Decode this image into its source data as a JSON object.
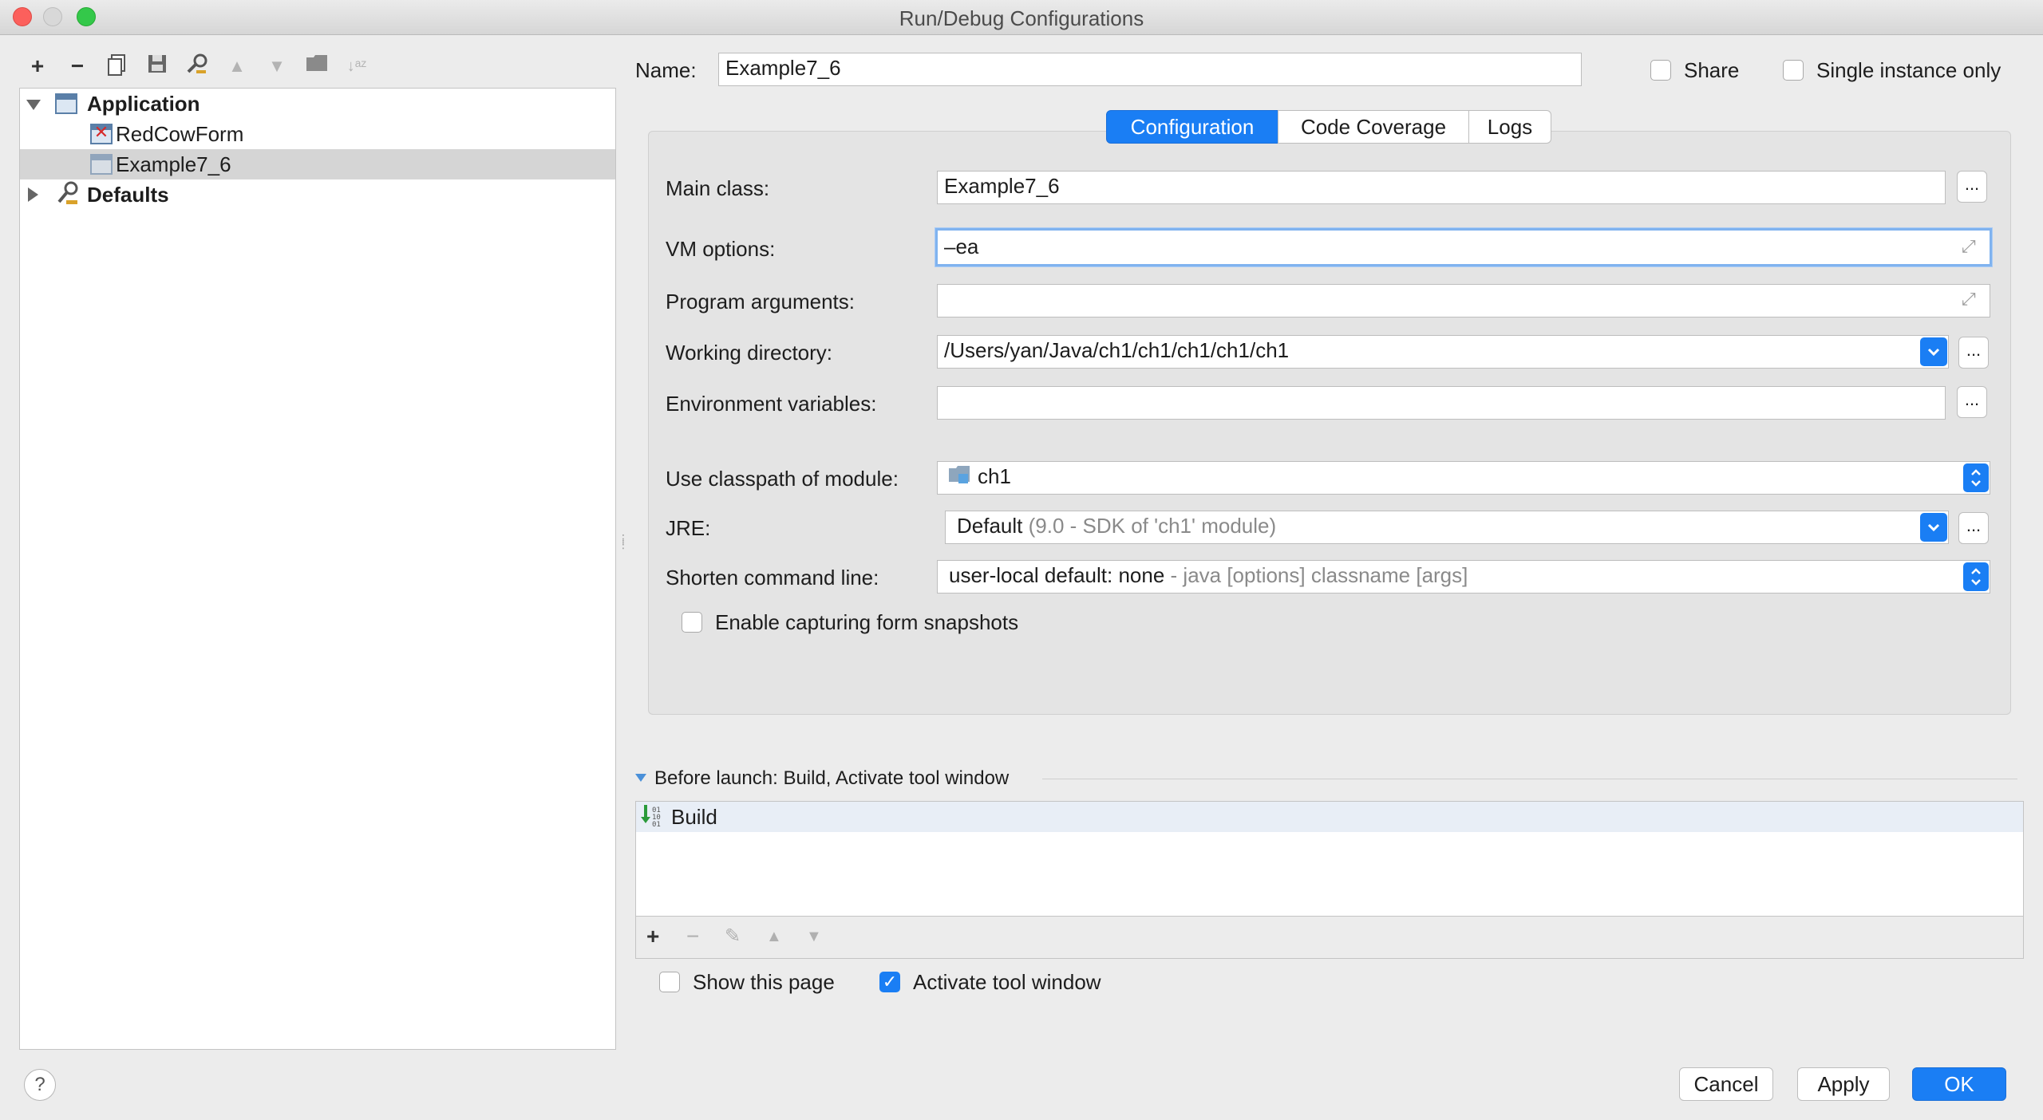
{
  "window": {
    "title": "Run/Debug Configurations"
  },
  "toolbar": {
    "add": "+",
    "remove": "−"
  },
  "tree": {
    "application": "Application",
    "items": [
      "RedCowForm",
      "Example7_6"
    ],
    "defaults": "Defaults"
  },
  "header": {
    "name_label": "Name:",
    "name_value": "Example7_6",
    "share_label": "Share",
    "single_instance_label": "Single instance only"
  },
  "tabs": [
    "Configuration",
    "Code Coverage",
    "Logs"
  ],
  "config": {
    "main_class_label": "Main class:",
    "main_class_value": "Example7_6",
    "vm_options_label": "VM options:",
    "vm_options_value": "–ea",
    "program_args_label": "Program arguments:",
    "program_args_value": "",
    "working_dir_label": "Working directory:",
    "working_dir_value": "/Users/yan/Java/ch1/ch1/ch1/ch1/ch1",
    "env_vars_label": "Environment variables:",
    "env_vars_value": "",
    "classpath_label": "Use classpath of module:",
    "classpath_value": "ch1",
    "jre_label": "JRE:",
    "jre_value": "Default",
    "jre_hint": "(9.0 - SDK of 'ch1' module)",
    "shorten_label": "Shorten command line:",
    "shorten_value": "user-local default: none",
    "shorten_hint": "- java [options] classname [args]",
    "snapshots_label": "Enable capturing form snapshots",
    "ellipsis": "..."
  },
  "before_launch": {
    "title": "Before launch: Build, Activate tool window",
    "items": [
      "Build"
    ],
    "show_page_label": "Show this page",
    "activate_label": "Activate tool window",
    "add": "+",
    "remove": "−"
  },
  "footer": {
    "help": "?",
    "cancel": "Cancel",
    "apply": "Apply",
    "ok": "OK"
  },
  "colors": {
    "accent": "#1a7ef4",
    "selection": "#d5d5d5",
    "focus_ring": "#80b3ef"
  }
}
